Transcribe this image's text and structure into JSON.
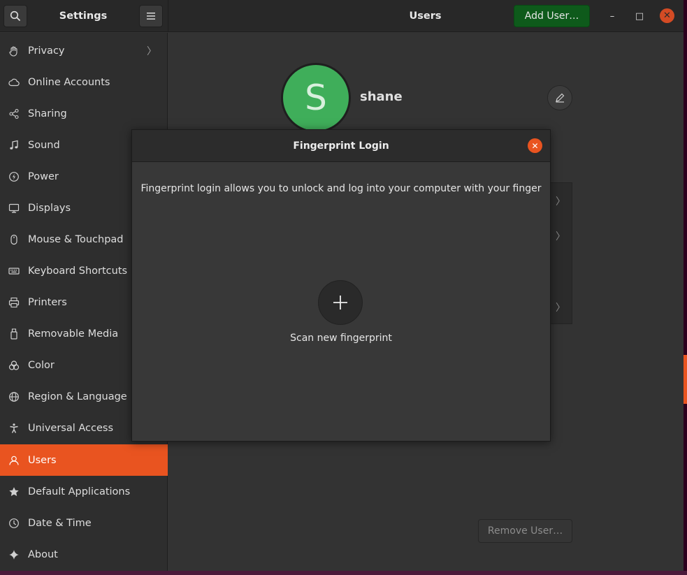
{
  "header": {
    "sidebar_title": "Settings",
    "main_title": "Users",
    "add_user_label": "Add User…",
    "minimize_glyph": "–",
    "maximize_glyph": "□",
    "close_glyph": "✕"
  },
  "sidebar": {
    "items": [
      {
        "label": "Privacy",
        "icon": "hand-icon",
        "has_chevron": true
      },
      {
        "label": "Online Accounts",
        "icon": "cloud-icon"
      },
      {
        "label": "Sharing",
        "icon": "share-icon"
      },
      {
        "label": "Sound",
        "icon": "music-note-icon"
      },
      {
        "label": "Power",
        "icon": "power-icon"
      },
      {
        "label": "Displays",
        "icon": "display-icon"
      },
      {
        "label": "Mouse & Touchpad",
        "icon": "mouse-icon"
      },
      {
        "label": "Keyboard Shortcuts",
        "icon": "keyboard-icon"
      },
      {
        "label": "Printers",
        "icon": "printer-icon"
      },
      {
        "label": "Removable Media",
        "icon": "usb-drive-icon"
      },
      {
        "label": "Color",
        "icon": "color-icon"
      },
      {
        "label": "Region & Language",
        "icon": "globe-icon"
      },
      {
        "label": "Universal Access",
        "icon": "accessibility-icon"
      },
      {
        "label": "Users",
        "icon": "user-icon",
        "active": true
      },
      {
        "label": "Default Applications",
        "icon": "star-icon"
      },
      {
        "label": "Date & Time",
        "icon": "clock-icon"
      },
      {
        "label": "About",
        "icon": "sparkle-icon"
      }
    ],
    "chevron": "〉"
  },
  "user": {
    "avatar_letter": "S",
    "name": "shane"
  },
  "main": {
    "remove_user_label": "Remove User…",
    "list_chevron": "〉"
  },
  "dialog": {
    "title": "Fingerprint Login",
    "description": "Fingerprint login allows you to unlock and log into your computer with your finger",
    "scan_label": "Scan new fingerprint",
    "close_glyph": "✕"
  },
  "colors": {
    "accent": "#e95420",
    "add_user_bg": "#0e5a1b",
    "avatar_bg": "#3fae5a"
  }
}
